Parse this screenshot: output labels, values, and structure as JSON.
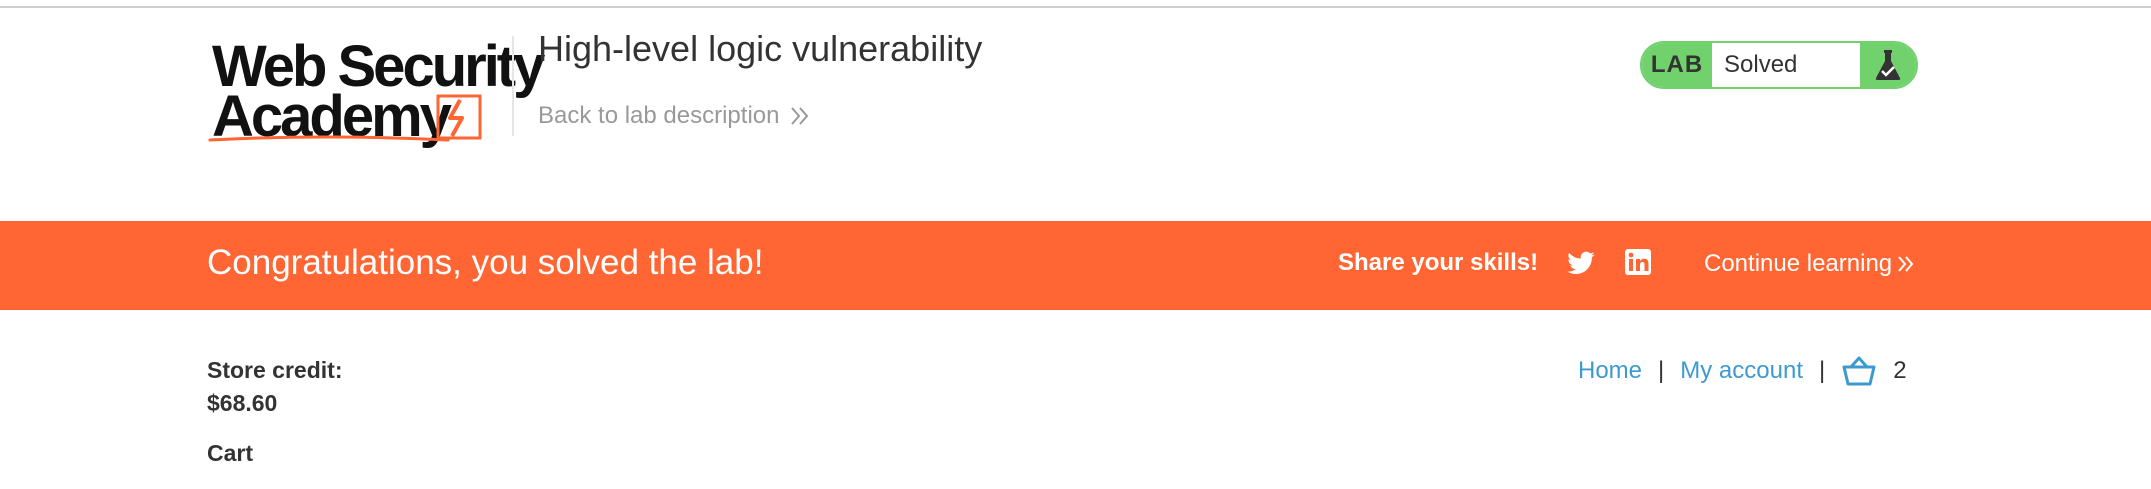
{
  "colors": {
    "brand_orange": "#ff6633",
    "lab_green": "#70d16d",
    "link_blue": "#3d9ad1",
    "text_dark": "#333333",
    "text_muted": "#999999"
  },
  "header": {
    "logo_line1": "Web Security",
    "logo_line2": "Academy",
    "logo_icon": "lightning-bolt-icon",
    "lab_title": "High-level logic vulnerability",
    "back_link": "Back to lab description",
    "back_icon": "double-chevron-right-icon",
    "lab_status": {
      "tag": "LAB",
      "state": "Solved",
      "icon": "flask-check-icon"
    }
  },
  "banner": {
    "message": "Congratulations, you solved the lab!",
    "share_label": "Share your skills!",
    "share_icons": [
      "twitter-icon",
      "linkedin-icon"
    ],
    "continue_link": "Continue learning",
    "continue_icon": "double-chevron-right-icon"
  },
  "account": {
    "store_credit_label": "Store credit:",
    "store_credit_value": "$68.60",
    "cart_heading": "Cart"
  },
  "nav": {
    "home": "Home",
    "separator": "|",
    "my_account": "My account",
    "cart_icon": "basket-icon",
    "cart_count": "2"
  }
}
